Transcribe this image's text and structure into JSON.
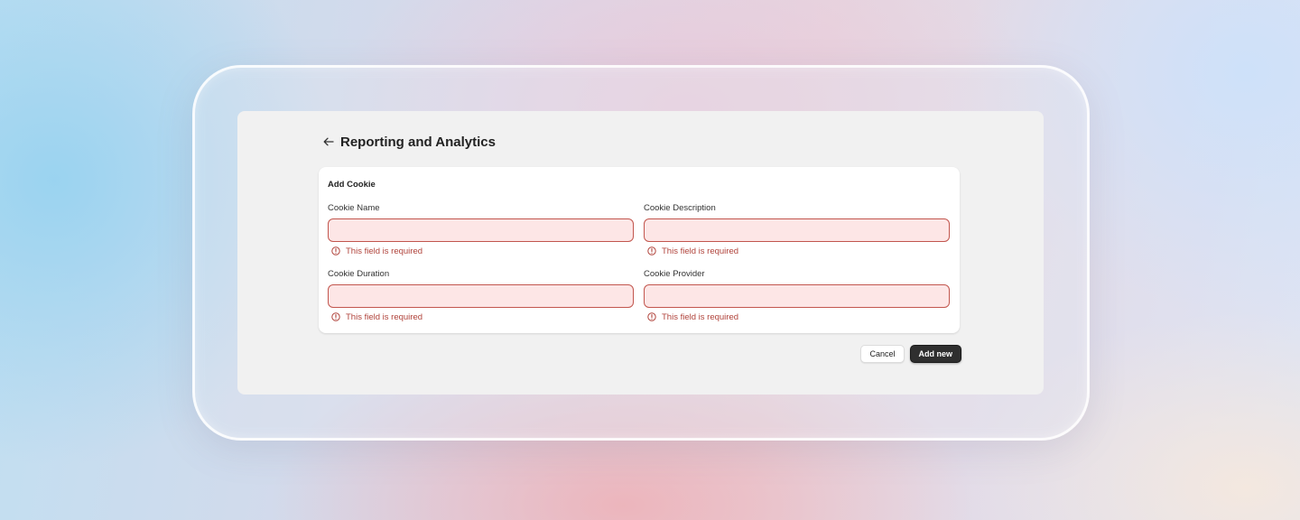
{
  "header": {
    "title": "Reporting and Analytics",
    "back_icon": "arrow-left-icon"
  },
  "form": {
    "title": "Add Cookie",
    "fields": [
      {
        "label": "Cookie Name",
        "value": "",
        "placeholder": "",
        "error": "This field is required"
      },
      {
        "label": "Cookie Description",
        "value": "",
        "placeholder": "",
        "error": "This field is required"
      },
      {
        "label": "Cookie Duration",
        "value": "",
        "placeholder": "",
        "error": "This field is required"
      },
      {
        "label": "Cookie Provider",
        "value": "",
        "placeholder": "",
        "error": "This field is required"
      }
    ]
  },
  "actions": {
    "cancel_label": "Cancel",
    "submit_label": "Add new"
  },
  "colors": {
    "error": "#b0433b",
    "error_border": "#c2564e",
    "error_fill": "#fde6e6",
    "primary_button": "#2f2f2f",
    "panel_bg": "#f1f1f1"
  }
}
